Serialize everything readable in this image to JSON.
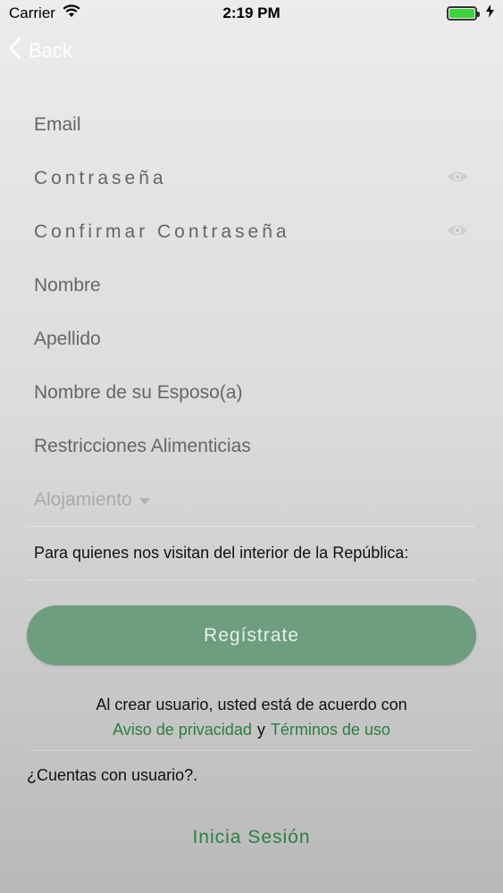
{
  "status_bar": {
    "carrier": "Carrier",
    "time": "2:19 PM"
  },
  "nav": {
    "back_label": "Back"
  },
  "form": {
    "email": "Email",
    "password": "Contraseña",
    "confirm_password": "Confirmar Contraseña",
    "first_name": "Nombre",
    "last_name": "Apellido",
    "spouse_name": "Nombre de su Esposo(a)",
    "dietary_restrictions": "Restricciones Alimenticias",
    "lodging": "Alojamiento",
    "note": "Para quienes nos visitan del interior de la República:"
  },
  "register_button": "Regístrate",
  "legal": {
    "line1": "Al crear usuario, usted está de acuerdo con",
    "privacy_link": "Aviso de privacidad",
    "conjunction": "y",
    "terms_link": "Términos de uso"
  },
  "account_question": "¿Cuentas con usuario?.",
  "login_button": "Inicia Sesión",
  "colors": {
    "accent_green": "#2c7d45",
    "button_green": "#6e9d80"
  }
}
